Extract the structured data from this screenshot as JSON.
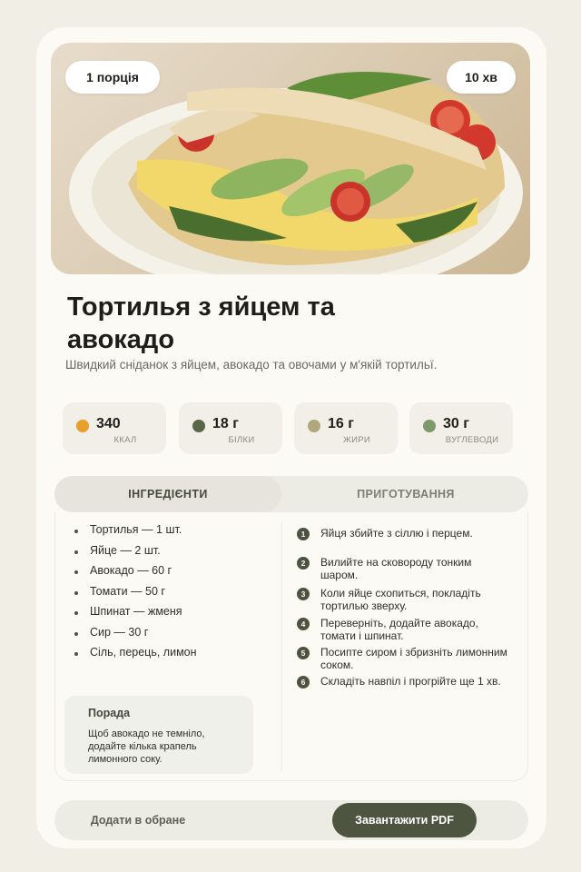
{
  "recipe": {
    "servings": "1 порція",
    "time": "10 хв",
    "title": "Тортилья з яйцем та авокадо",
    "subtitle": "Швидкий сніданок з яйцем, авокадо та овочами у м'якій тортильї."
  },
  "nutrition": [
    {
      "value": "340",
      "label": "ККАЛ",
      "color": "#e7a02c"
    },
    {
      "value": "18 г",
      "label": "БІЛКИ",
      "color": "#5a6648"
    },
    {
      "value": "16 г",
      "label": "ЖИРИ",
      "color": "#b2a77c"
    },
    {
      "value": "30 г",
      "label": "ВУГЛЕВОДИ",
      "color": "#7e9a6a"
    }
  ],
  "tabs": {
    "ingredients": "ІНГРЕДІЄНТИ",
    "preparation": "ПРИГОТУВАННЯ"
  },
  "ingredients": [
    "Тортилья — 1 шт.",
    "Яйце — 2 шт.",
    "Авокадо — 60 г",
    "Томати — 50 г",
    "Шпинат — жменя",
    "Сир — 30 г",
    "Сіль, перець, лимон"
  ],
  "tip": {
    "title": "Порада",
    "text": "Щоб авокадо не темніло, додайте кілька крапель лимонного соку."
  },
  "steps": [
    {
      "num": "1",
      "text": "Яйця збийте з сіллю і перцем."
    },
    {
      "num": "2",
      "text": "Вилийте на сковороду тонким шаром."
    },
    {
      "num": "3",
      "text": "Коли яйце схопиться, покладіть тортилью зверху."
    },
    {
      "num": "4",
      "text": "Переверніть, додайте авокадо, томати і шпинат."
    },
    {
      "num": "5",
      "text": "Посипте сиром і збризніть лимонним соком."
    },
    {
      "num": "6",
      "text": "Складіть навпіл і прогрійте ще 1 хв."
    }
  ],
  "actions": {
    "favorite": "Додати в обране",
    "pdf": "Завантажити PDF"
  },
  "colors": {
    "accent": "#4d5440",
    "background": "#f1eee6",
    "card": "#fbfaf5"
  }
}
